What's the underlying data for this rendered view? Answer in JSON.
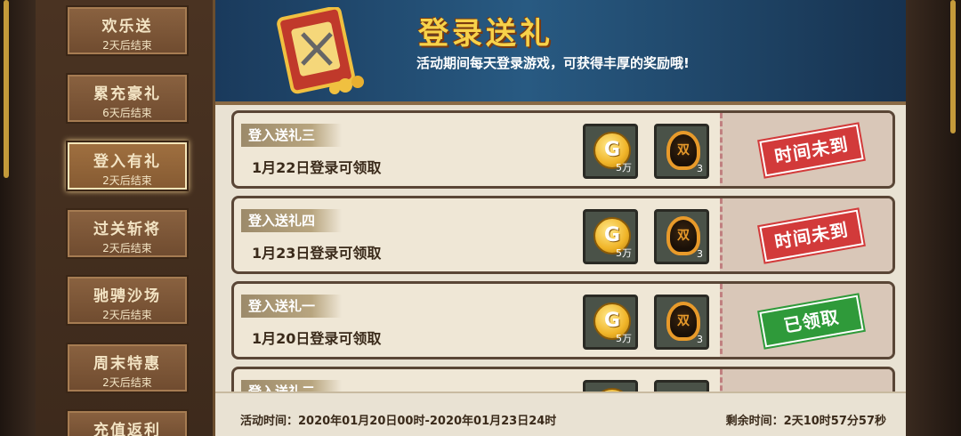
{
  "sidebar": {
    "items": [
      {
        "title": "欢乐送",
        "sub": "2天后结束"
      },
      {
        "title": "累充豪礼",
        "sub": "6天后结束"
      },
      {
        "title": "登入有礼",
        "sub": "2天后结束"
      },
      {
        "title": "过关斩将",
        "sub": "2天后结束"
      },
      {
        "title": "驰骋沙场",
        "sub": "2天后结束"
      },
      {
        "title": "周末特惠",
        "sub": "2天后结束"
      },
      {
        "title": "充值返利",
        "sub": ""
      }
    ],
    "active_index": 2
  },
  "banner": {
    "title": "登录送礼",
    "subtitle": "活动期间每天登录游戏，可获得丰厚的奖励哦!"
  },
  "rewards": [
    {
      "name": "登入送礼三",
      "desc": "1月22日登录可领取",
      "coin_label": "G",
      "coin_count": "5万",
      "token_label": "双",
      "token_count": "3",
      "status": "时间未到",
      "status_type": "red"
    },
    {
      "name": "登入送礼四",
      "desc": "1月23日登录可领取",
      "coin_label": "G",
      "coin_count": "5万",
      "token_label": "双",
      "token_count": "3",
      "status": "时间未到",
      "status_type": "red"
    },
    {
      "name": "登入送礼一",
      "desc": "1月20日登录可领取",
      "coin_label": "G",
      "coin_count": "5万",
      "token_label": "双",
      "token_count": "3",
      "status": "已领取",
      "status_type": "green"
    },
    {
      "name": "登入送礼二",
      "desc": "",
      "coin_label": "",
      "coin_count": "",
      "token_label": "",
      "token_count": "",
      "status": "",
      "status_type": "green"
    }
  ],
  "footer": {
    "period": "活动时间：2020年01月20日00时-2020年01月23日24时",
    "remaining": "剩余时间：2天10时57分57秒"
  },
  "colors": {
    "stamp_red": "#d23a3a",
    "stamp_green": "#2f9a3a",
    "title_gold": "#f7d24a"
  }
}
